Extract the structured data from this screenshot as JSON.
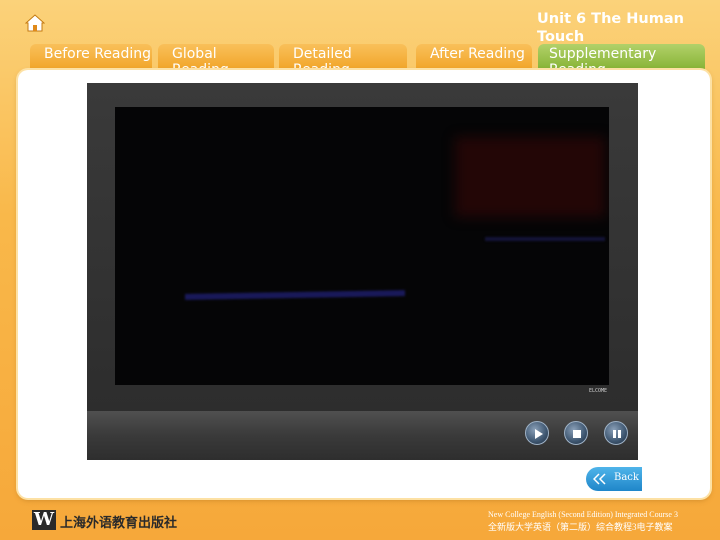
{
  "header": {
    "unit_title": "Unit 6 The Human Touch"
  },
  "tabs": [
    {
      "label": "Before Reading",
      "active": false
    },
    {
      "label": "Global Reading",
      "active": false
    },
    {
      "label": "Detailed Reading",
      "active": false
    },
    {
      "label": "After Reading",
      "active": false
    },
    {
      "label": "Supplementary Reading",
      "active": true
    }
  ],
  "video": {
    "brand_mark": "ELCOME",
    "controls": [
      {
        "name": "play",
        "icon": "play-icon"
      },
      {
        "name": "stop",
        "icon": "stop-icon"
      },
      {
        "name": "pause",
        "icon": "pause-icon"
      }
    ]
  },
  "back_button": {
    "label": "Back",
    "icon": "double-chevron-left-icon"
  },
  "footer": {
    "publisher_logo_letter": "W",
    "publisher_name": "上海外语教育出版社",
    "course_en": "New College English (Second Edition) Integrated Course 3",
    "course_cn": "全新版大学英语（第二版）综合教程3电子教案"
  },
  "colors": {
    "background": "#f9b84a",
    "tab": "#f0a020",
    "tab_active": "#7fae2c",
    "back_button": "#1f86c9"
  }
}
